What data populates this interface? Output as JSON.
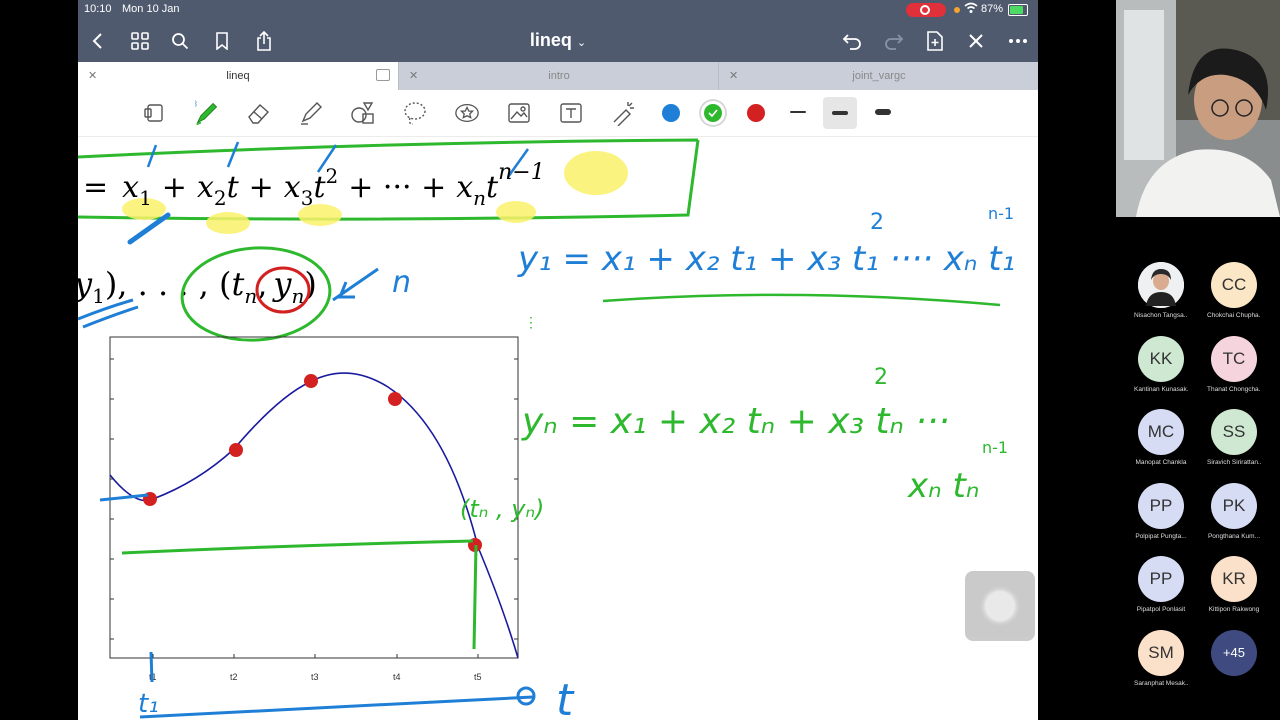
{
  "status": {
    "time": "10:10",
    "date": "Mon 10 Jan",
    "battery": "87%"
  },
  "nav": {
    "title": "lineq"
  },
  "tabs": [
    {
      "label": "lineq",
      "active": true
    },
    {
      "label": "intro",
      "active": false
    },
    {
      "label": "joint_vargc",
      "active": false
    }
  ],
  "toolbar": {
    "tools": [
      "document-icon",
      "pen-icon",
      "eraser-icon",
      "highlighter-icon",
      "shapes-icon",
      "lasso-icon",
      "sticker-icon",
      "image-icon",
      "text-icon",
      "laser-icon"
    ],
    "colors": [
      "#1f7fd6",
      "#2eb82e",
      "#d32020"
    ],
    "selected_color": "#2eb82e",
    "selected_stroke": "medium"
  },
  "notes": {
    "eq1": [
      "=",
      "x",
      "1",
      "+",
      "x",
      "2",
      "t",
      "+",
      "x",
      "3",
      "t",
      "2",
      "+ ··· +",
      "x",
      "n",
      "t",
      "n−1"
    ],
    "eq2": [
      "y",
      "1",
      "), . . . , (",
      "t",
      "n",
      ",",
      "y",
      "n",
      ")"
    ],
    "n_label": "n",
    "ticks": [
      "t1",
      "t2",
      "t3",
      "t4",
      "t5"
    ],
    "hw_y1": "y₁ = x₁ + x₂ t₁ + x₃ t₁ ···· xₙ t₁",
    "hw_y1_sup2": "2",
    "hw_y1_supn": "n-1",
    "hw_yn": "yₙ = x₁ + x₂ tₙ + x₃ tₙ ···",
    "hw_yn_sup2": "2",
    "hw_yn_supn": "n-1",
    "hw_xntn": "xₙ tₙ",
    "hw_point": "(tₙ , yₙ)",
    "hw_t1": "t₁",
    "hw_t": "t"
  },
  "participants": [
    {
      "initials": "",
      "name": "Nisachon Tangsa...",
      "color": "#f4f4f4",
      "photo": true
    },
    {
      "initials": "CC",
      "name": "Chokchai Chupha...",
      "color": "#fbe7c6"
    },
    {
      "initials": "KK",
      "name": "Kantinan Kunasak...",
      "color": "#cfe8d2"
    },
    {
      "initials": "TC",
      "name": "Thanat Chongcha...",
      "color": "#f6d4de"
    },
    {
      "initials": "MC",
      "name": "Manopat Chankla",
      "color": "#d7dcf5"
    },
    {
      "initials": "SS",
      "name": "Siravich Sirirattan...",
      "color": "#cfe8d2"
    },
    {
      "initials": "PP",
      "name": "Polpipat Pungta...",
      "color": "#d7dcf5"
    },
    {
      "initials": "PK",
      "name": "Pongthana Kum...",
      "color": "#d7dcf5"
    },
    {
      "initials": "PP",
      "name": "Pipatpol Ponlasit",
      "color": "#d7dcf5"
    },
    {
      "initials": "KR",
      "name": "Kittipon Rakwong",
      "color": "#fbe1c9"
    },
    {
      "initials": "SM",
      "name": "Saranphat Mesak...",
      "color": "#fbe1c9"
    },
    {
      "initials": "+45",
      "name": "",
      "color": "#3f4a80"
    }
  ]
}
